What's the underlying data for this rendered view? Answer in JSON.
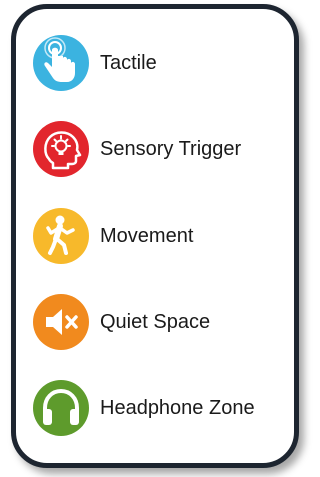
{
  "legend": {
    "items": [
      {
        "label": "Tactile",
        "icon": "hand-touch-icon",
        "color": "#3bb3e0"
      },
      {
        "label": "Sensory Trigger",
        "icon": "head-lightbulb-icon",
        "color": "#e2262d"
      },
      {
        "label": "Movement",
        "icon": "running-person-icon",
        "color": "#f7b92b"
      },
      {
        "label": "Quiet Space",
        "icon": "speaker-mute-icon",
        "color": "#f18a1e"
      },
      {
        "label": "Headphone Zone",
        "icon": "headphones-icon",
        "color": "#5e9b2c"
      }
    ]
  }
}
